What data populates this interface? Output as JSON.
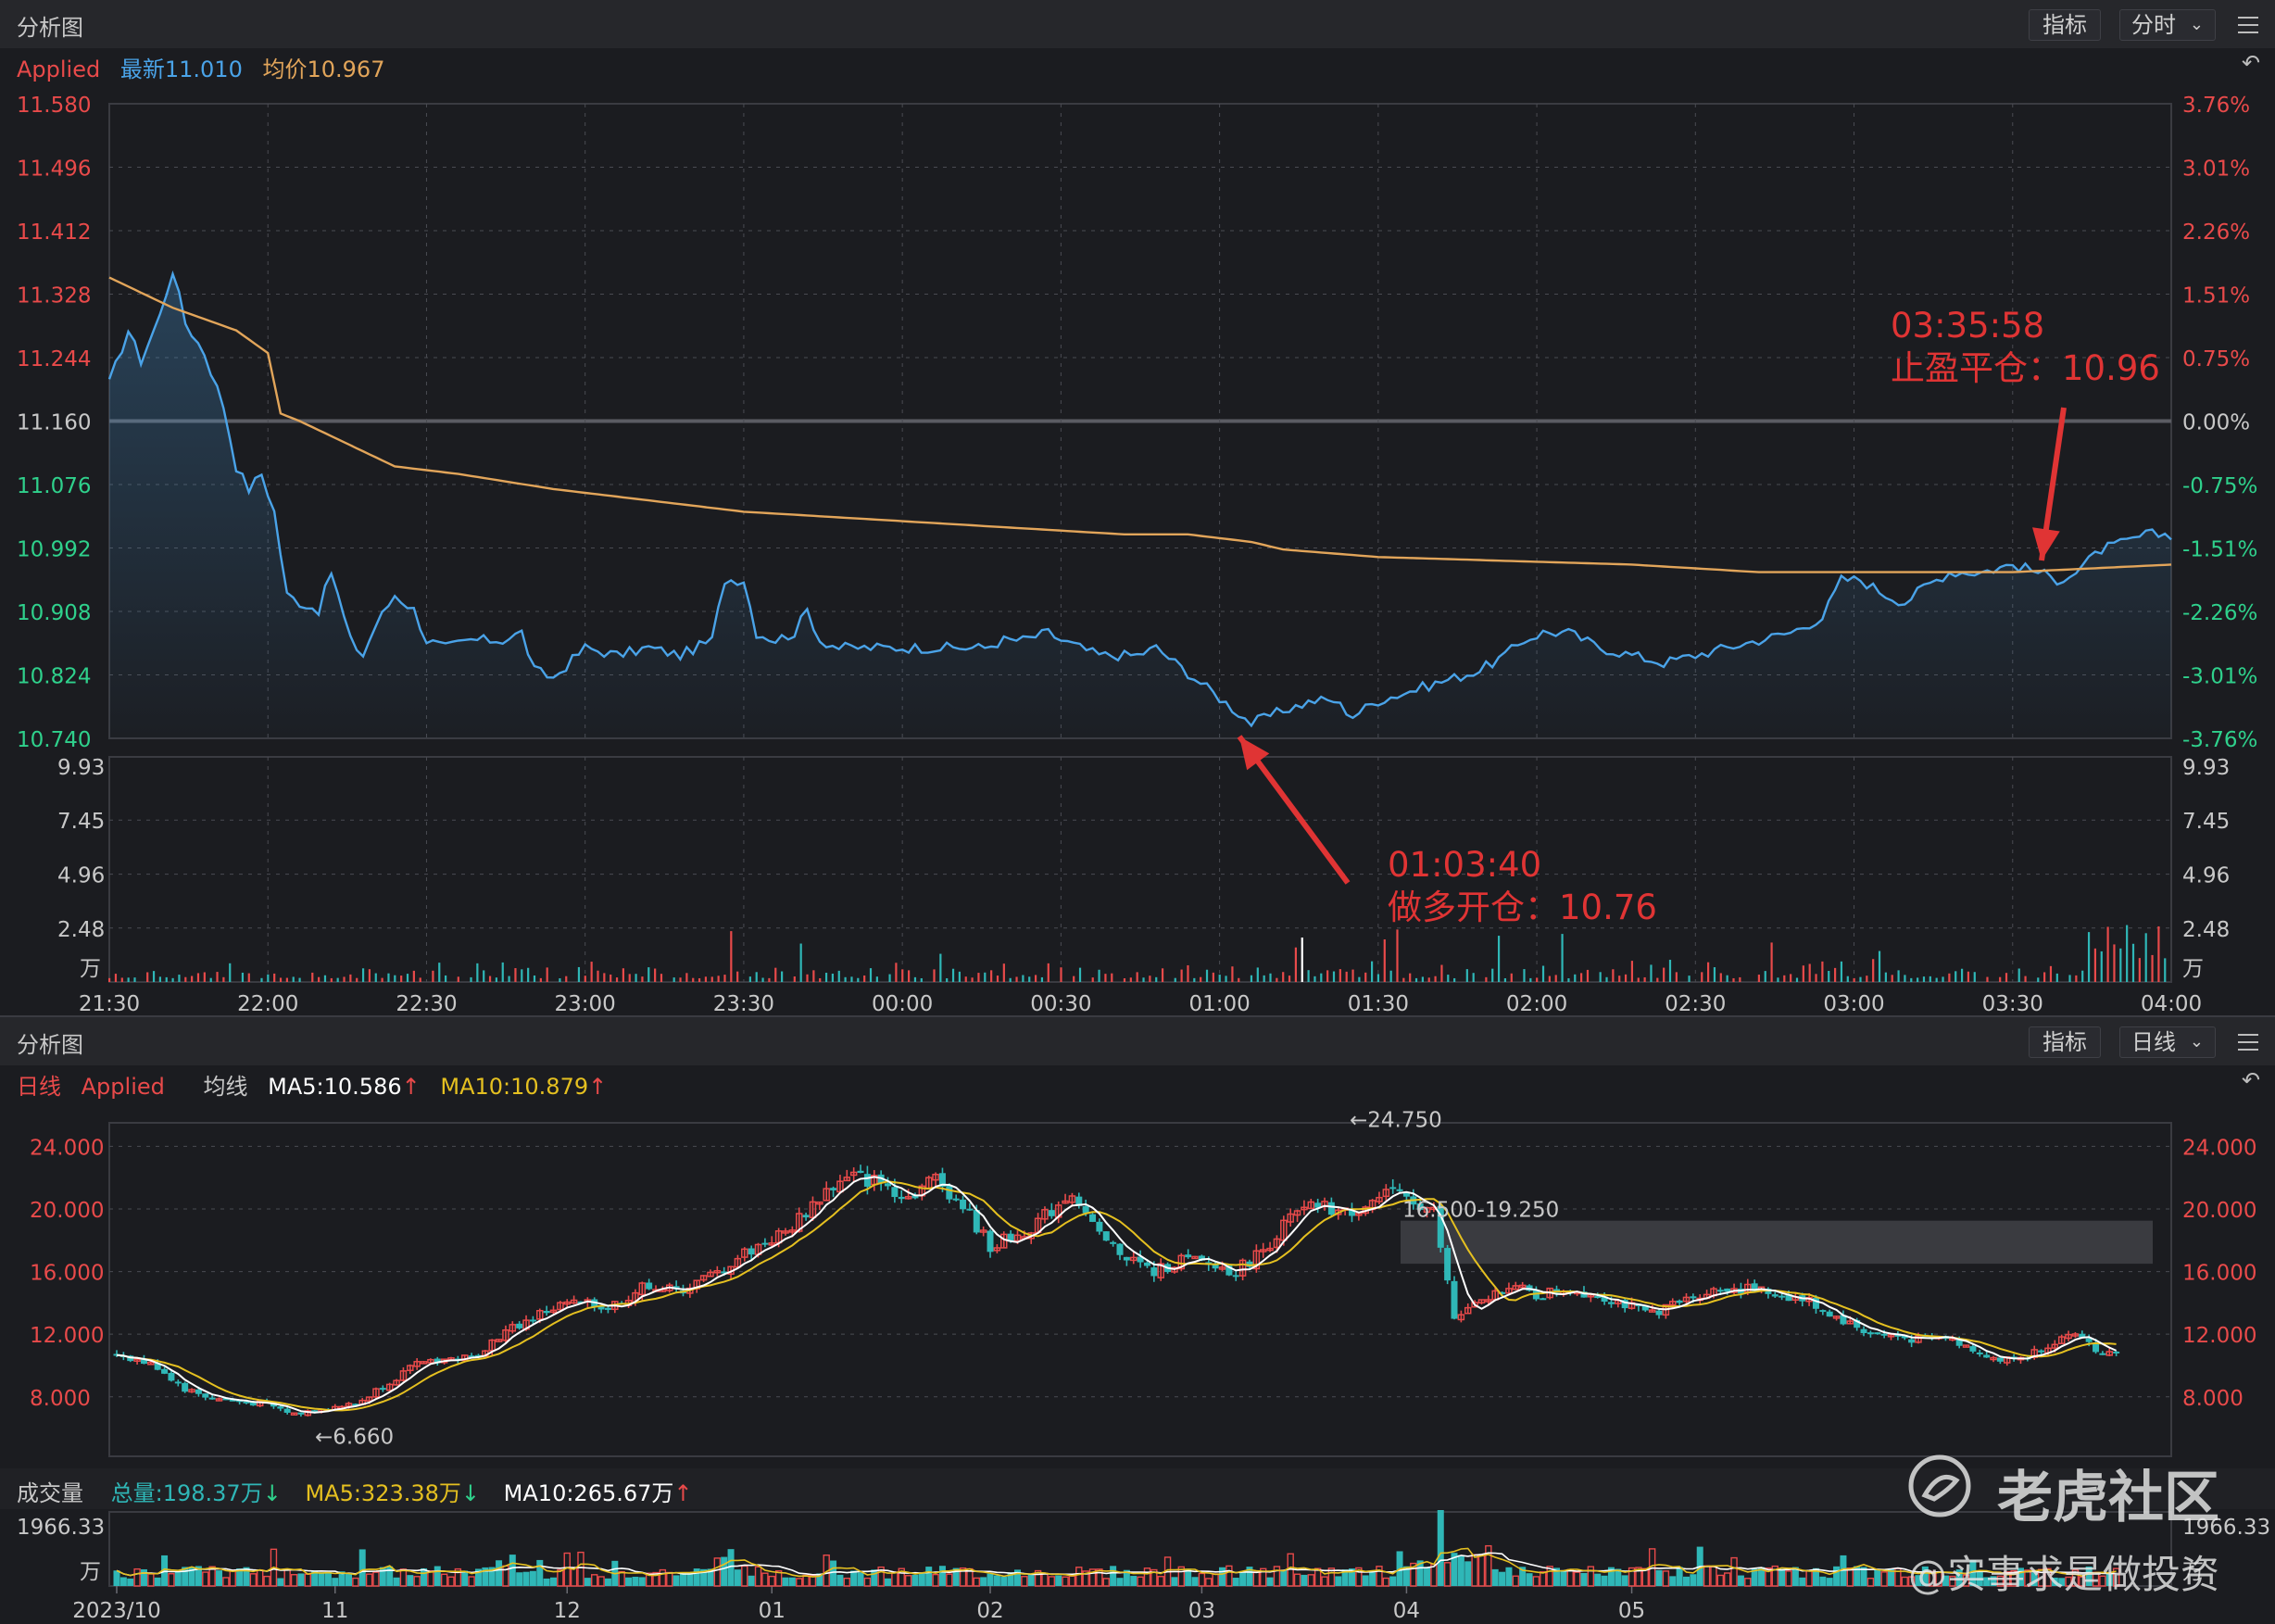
{
  "colors": {
    "up": "#e84a4a",
    "down": "#2fb7b7",
    "price": "#4aa3e8",
    "avg": "#e2a55a",
    "ma5": "#ffffff",
    "ma10": "#e5c020",
    "grid": "#4a4b52",
    "neutral": "#c8c8c8",
    "annotation": "#e03434"
  },
  "top_panel": {
    "title": "分析图",
    "indicator_button": "指标",
    "period_button": "分时",
    "menu_icon": "menu-icon",
    "reset_icon": "undo-icon",
    "legend": {
      "name": "Applied",
      "latest": "最新11.010",
      "avg": "均价10.967"
    },
    "annotations": [
      {
        "time": "01:03:40",
        "label": "做多开仓：10.76"
      },
      {
        "time": "03:35:58",
        "label": "止盈平仓：10.96"
      }
    ],
    "volume_unit": "万"
  },
  "bottom_panel": {
    "title": "分析图",
    "indicator_button": "指标",
    "period_button": "日线",
    "menu_icon": "menu-icon",
    "reset_icon": "undo-icon",
    "legend": {
      "period": "日线",
      "name": "Applied",
      "ma_label": "均线",
      "ma5": "MA5:10.586",
      "ma10": "MA10:10.879"
    },
    "high_label": "←24.750",
    "low_label": "←6.660",
    "gap_label": "16.500-19.250",
    "volume_legend": {
      "title": "成交量",
      "total": "总量:198.37万",
      "ma5": "MA5:323.38万",
      "ma10": "MA10:265.67万"
    },
    "volume_unit": "万",
    "volume_max": "1966.33"
  },
  "watermark": {
    "brand": "老虎社区",
    "handle": "@实事求是做投资",
    "logo_icon": "tiger-logo-icon"
  },
  "chart_data": [
    {
      "type": "line",
      "title": "",
      "x_ticks": [
        "21:30",
        "22:00",
        "22:30",
        "23:00",
        "23:30",
        "00:00",
        "00:30",
        "01:00",
        "01:30",
        "02:00",
        "02:30",
        "03:00",
        "03:30",
        "04:00"
      ],
      "y_ticks": [
        "11.580",
        "11.496",
        "11.412",
        "11.328",
        "11.244",
        "11.160",
        "11.076",
        "10.992",
        "10.908",
        "10.824",
        "10.740"
      ],
      "pct_ticks": [
        "3.76%",
        "3.01%",
        "2.26%",
        "1.51%",
        "0.75%",
        "0.00%",
        "-0.75%",
        "-1.51%",
        "-2.26%",
        "-3.01%",
        "-3.76%"
      ],
      "ylim": [
        10.74,
        11.58
      ],
      "prev_close": 11.16,
      "volume_ticks": [
        "9.93",
        "7.45",
        "4.96",
        "2.48"
      ],
      "volume_ylim": [
        0,
        9.93
      ],
      "series": [
        {
          "name": "最新",
          "anchors": [
            [
              0,
              11.21
            ],
            [
              3,
              11.28
            ],
            [
              5,
              11.24
            ],
            [
              8,
              11.3
            ],
            [
              10,
              11.36
            ],
            [
              12,
              11.29
            ],
            [
              15,
              11.25
            ],
            [
              18,
              11.18
            ],
            [
              20,
              11.1
            ],
            [
              22,
              11.07
            ],
            [
              24,
              11.09
            ],
            [
              26,
              11.04
            ],
            [
              28,
              10.93
            ],
            [
              30,
              10.92
            ],
            [
              33,
              10.91
            ],
            [
              35,
              10.96
            ],
            [
              38,
              10.87
            ],
            [
              40,
              10.85
            ],
            [
              42,
              10.89
            ],
            [
              45,
              10.93
            ],
            [
              48,
              10.91
            ],
            [
              50,
              10.87
            ],
            [
              53,
              10.86
            ],
            [
              57,
              10.87
            ],
            [
              62,
              10.87
            ],
            [
              65,
              10.88
            ],
            [
              67,
              10.83
            ],
            [
              70,
              10.82
            ],
            [
              75,
              10.86
            ],
            [
              80,
              10.85
            ],
            [
              85,
              10.86
            ],
            [
              90,
              10.85
            ],
            [
              95,
              10.87
            ],
            [
              97,
              10.95
            ],
            [
              100,
              10.95
            ],
            [
              102,
              10.88
            ],
            [
              105,
              10.87
            ],
            [
              108,
              10.88
            ],
            [
              110,
              10.91
            ],
            [
              112,
              10.87
            ],
            [
              115,
              10.86
            ],
            [
              120,
              10.86
            ],
            [
              125,
              10.86
            ],
            [
              130,
              10.86
            ],
            [
              135,
              10.86
            ],
            [
              138,
              10.86
            ],
            [
              141,
              10.87
            ],
            [
              144,
              10.87
            ],
            [
              148,
              10.88
            ],
            [
              150,
              10.87
            ],
            [
              153,
              10.86
            ],
            [
              156,
              10.85
            ],
            [
              159,
              10.85
            ],
            [
              162,
              10.85
            ],
            [
              165,
              10.86
            ],
            [
              168,
              10.84
            ],
            [
              171,
              10.82
            ],
            [
              174,
              10.8
            ],
            [
              177,
              10.78
            ],
            [
              180,
              10.76
            ],
            [
              183,
              10.77
            ],
            [
              186,
              10.78
            ],
            [
              190,
              10.79
            ],
            [
              193,
              10.79
            ],
            [
              196,
              10.77
            ],
            [
              200,
              10.79
            ],
            [
              204,
              10.8
            ],
            [
              208,
              10.81
            ],
            [
              212,
              10.82
            ],
            [
              216,
              10.83
            ],
            [
              220,
              10.85
            ],
            [
              223,
              10.87
            ],
            [
              226,
              10.88
            ],
            [
              230,
              10.88
            ],
            [
              235,
              10.86
            ],
            [
              240,
              10.85
            ],
            [
              245,
              10.84
            ],
            [
              250,
              10.85
            ],
            [
              255,
              10.86
            ],
            [
              260,
              10.87
            ],
            [
              265,
              10.88
            ],
            [
              270,
              10.9
            ],
            [
              273,
              10.95
            ],
            [
              276,
              10.95
            ],
            [
              280,
              10.93
            ],
            [
              283,
              10.92
            ],
            [
              286,
              10.94
            ],
            [
              290,
              10.96
            ],
            [
              295,
              10.96
            ],
            [
              300,
              10.97
            ],
            [
              304,
              10.96
            ],
            [
              307,
              10.95
            ],
            [
              310,
              10.96
            ],
            [
              314,
              10.99
            ],
            [
              318,
              11.0
            ],
            [
              321,
              11.01
            ],
            [
              325,
              11.01
            ]
          ]
        },
        {
          "name": "均价",
          "anchors": [
            [
              0,
              11.35
            ],
            [
              10,
              11.31
            ],
            [
              20,
              11.28
            ],
            [
              25,
              11.25
            ],
            [
              27,
              11.17
            ],
            [
              30,
              11.16
            ],
            [
              35,
              11.14
            ],
            [
              40,
              11.12
            ],
            [
              45,
              11.1
            ],
            [
              55,
              11.09
            ],
            [
              70,
              11.07
            ],
            [
              80,
              11.06
            ],
            [
              100,
              11.04
            ],
            [
              120,
              11.03
            ],
            [
              140,
              11.02
            ],
            [
              160,
              11.01
            ],
            [
              170,
              11.01
            ],
            [
              180,
              11.0
            ],
            [
              185,
              10.99
            ],
            [
              200,
              10.98
            ],
            [
              240,
              10.97
            ],
            [
              260,
              10.96
            ],
            [
              300,
              10.96
            ],
            [
              325,
              10.97
            ]
          ]
        }
      ]
    },
    {
      "type": "candlestick",
      "title": "",
      "x_ticks": [
        "2023/10",
        "11",
        "12",
        "01",
        "02",
        "03",
        "04",
        "05"
      ],
      "y_ticks": [
        "24.000",
        "20.000",
        "16.000",
        "12.000",
        "8.000"
      ],
      "ylim": [
        4.2,
        25.5
      ],
      "anchors": [
        [
          0,
          10.8
        ],
        [
          6,
          9.9
        ],
        [
          10,
          8.5
        ],
        [
          14,
          7.9
        ],
        [
          18,
          7.7
        ],
        [
          22,
          7.5
        ],
        [
          26,
          6.9
        ],
        [
          30,
          7.3
        ],
        [
          35,
          7.5
        ],
        [
          40,
          9.0
        ],
        [
          45,
          10.3
        ],
        [
          52,
          10.5
        ],
        [
          56,
          11.9
        ],
        [
          62,
          13.3
        ],
        [
          66,
          14.0
        ],
        [
          72,
          13.7
        ],
        [
          78,
          15.2
        ],
        [
          82,
          14.7
        ],
        [
          88,
          15.9
        ],
        [
          92,
          17.2
        ],
        [
          98,
          18.5
        ],
        [
          104,
          21.2
        ],
        [
          108,
          22.0
        ],
        [
          112,
          21.7
        ],
        [
          116,
          20.8
        ],
        [
          120,
          22.0
        ],
        [
          124,
          20.2
        ],
        [
          128,
          17.6
        ],
        [
          132,
          18.3
        ],
        [
          136,
          19.5
        ],
        [
          140,
          21.2
        ],
        [
          144,
          18.1
        ],
        [
          148,
          17.0
        ],
        [
          152,
          15.9
        ],
        [
          156,
          16.8
        ],
        [
          160,
          16.4
        ],
        [
          164,
          16.0
        ],
        [
          168,
          17.4
        ],
        [
          172,
          19.4
        ],
        [
          176,
          20.2
        ],
        [
          180,
          19.7
        ],
        [
          184,
          20.5
        ],
        [
          188,
          21.0
        ],
        [
          190,
          20.6
        ],
        [
          193,
          19.8
        ],
        [
          196,
          13.0
        ],
        [
          200,
          14.0
        ],
        [
          204,
          15.2
        ],
        [
          208,
          14.4
        ],
        [
          212,
          14.9
        ],
        [
          216,
          14.6
        ],
        [
          220,
          14.1
        ],
        [
          224,
          13.3
        ],
        [
          228,
          13.8
        ],
        [
          232,
          14.6
        ],
        [
          236,
          15.0
        ],
        [
          240,
          14.8
        ],
        [
          244,
          14.5
        ],
        [
          248,
          14.1
        ],
        [
          252,
          13.1
        ],
        [
          256,
          12.2
        ],
        [
          260,
          11.9
        ],
        [
          264,
          11.6
        ],
        [
          268,
          11.8
        ],
        [
          272,
          11.1
        ],
        [
          276,
          10.3
        ],
        [
          280,
          10.6
        ],
        [
          284,
          11.6
        ],
        [
          288,
          11.8
        ],
        [
          291,
          10.7
        ],
        [
          293,
          10.9
        ]
      ],
      "ma5": "MA5:10.586",
      "ma10": "MA10:10.879",
      "high": 24.75,
      "low": 6.66,
      "gap_zone": [
        16.5,
        19.25
      ],
      "volume_max": 1966.33
    }
  ]
}
